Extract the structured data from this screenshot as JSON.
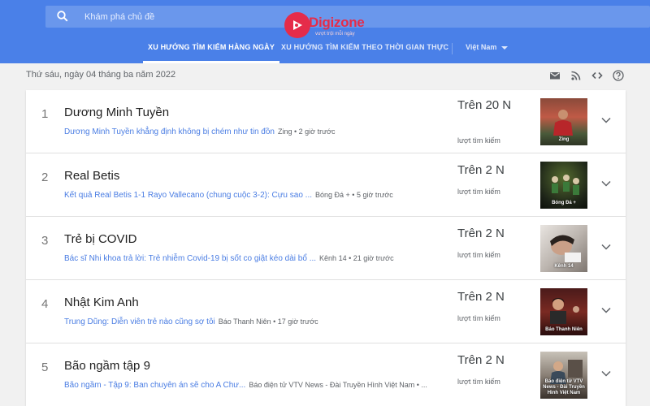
{
  "search": {
    "placeholder": "Khám phá chủ đề"
  },
  "logo": {
    "name": "Digizone",
    "tagline": "vượt trội mỗi ngày"
  },
  "tabs": [
    {
      "label": "XU HƯỚNG TÌM KIẾM HÀNG NGÀY",
      "active": true
    },
    {
      "label": "XU HƯỚNG TÌM KIẾM THEO THỜI GIAN THỰC",
      "active": false
    }
  ],
  "country": "Việt Nam",
  "date": "Thứ sáu, ngày 04 tháng ba năm 2022",
  "toolbar_icons": [
    "mail-icon",
    "rss-icon",
    "embed-code-icon",
    "help-icon"
  ],
  "trends": [
    {
      "rank": "1",
      "title": "Dương Minh Tuyền",
      "article": "Dương Minh Tuyền khẳng định không bị chém như tin đồn",
      "meta": "Zing • 2 giờ trước",
      "count": "Trên 20 N",
      "count_label": "lượt tìm kiếm",
      "thumb_caption": "Zing"
    },
    {
      "rank": "2",
      "title": "Real Betis",
      "article": "Kết quả Real Betis 1-1 Rayo Vallecano (chung cuộc 3-2): Cựu sao ...",
      "meta": "Bóng Đá + • 5 giờ trước",
      "count": "Trên 2 N",
      "count_label": "lượt tìm kiếm",
      "thumb_caption": "Bóng Đá +"
    },
    {
      "rank": "3",
      "title": "Trẻ bị COVID",
      "article": "Bác sĩ Nhi khoa trả lời: Trẻ nhiễm Covid-19 bị sốt co giật kéo dài bổ ...",
      "meta": "Kênh 14 • 21 giờ trước",
      "count": "Trên 2 N",
      "count_label": "lượt tìm kiếm",
      "thumb_caption": "Kênh 14"
    },
    {
      "rank": "4",
      "title": "Nhật Kim Anh",
      "article": "Trung Dũng: Diễn viên trẻ nào cũng sợ tôi",
      "meta": "Báo Thanh Niên • 17 giờ trước",
      "count": "Trên 2 N",
      "count_label": "lượt tìm kiếm",
      "thumb_caption": "Báo Thanh Niên"
    },
    {
      "rank": "5",
      "title": "Bão ngầm tập 9",
      "article": "Bão ngầm - Tập 9: Ban chuyên án sẽ cho A Chư...",
      "meta": "Báo điện tử VTV News - Đài Truyền Hình Việt Nam • ...",
      "count": "Trên 2 N",
      "count_label": "lượt tìm kiếm",
      "thumb_caption": "Báo điện tử VTV News - Đài Truyền Hình Việt Nam"
    }
  ]
}
